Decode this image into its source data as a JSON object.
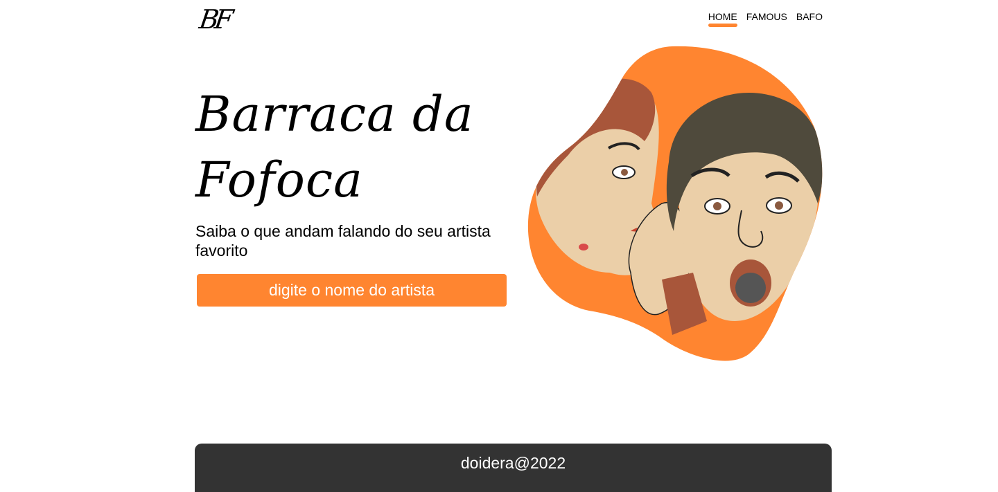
{
  "header": {
    "logo_text": "BF",
    "nav": [
      {
        "label": "HOME",
        "active": true
      },
      {
        "label": "FAMOUS",
        "active": false
      },
      {
        "label": "BAFO",
        "active": false
      }
    ]
  },
  "hero": {
    "title_line1": "Barraca da",
    "title_line2": "Fofoca",
    "subtitle": "Saiba o que andam falando do seu artista favorito",
    "search_button_label": "digite o nome do artista",
    "illustration": "two-women-whispering-gossip-illustration"
  },
  "footer": {
    "text": "doidera@2022"
  },
  "colors": {
    "accent": "#ff8530",
    "footer_bg": "#333333",
    "skin": "#ebcfa8",
    "hair_red": "#a8563a",
    "hair_dark": "#4f4a3c"
  }
}
